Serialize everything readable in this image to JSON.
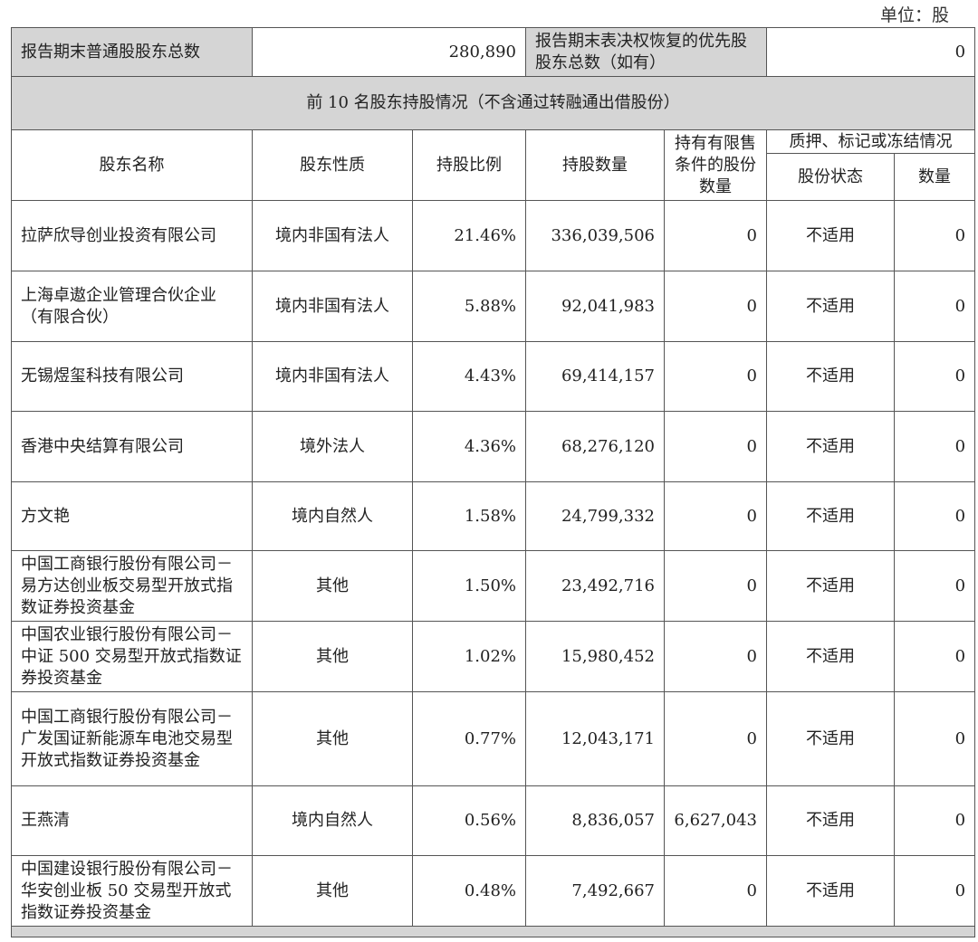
{
  "unit_label": "单位：股",
  "summary": {
    "total_holders_label": "报告期末普通股股东总数",
    "total_holders_value": "280,890",
    "preferred_label": "报告期末表决权恢复的优先股股东总数（如有）",
    "preferred_value": "0"
  },
  "section_title": "前 10 名股东持股情况（不含通过转融通出借股份）",
  "headers": {
    "name": "股东名称",
    "nature": "股东性质",
    "ratio": "持股比例",
    "quantity": "持股数量",
    "restricted": "持有有限售条件的股份数量",
    "pledge_group": "质押、标记或冻结情况",
    "pledge_status": "股份状态",
    "pledge_quantity": "数量"
  },
  "rows": [
    {
      "name": "拉萨欣导创业投资有限公司",
      "nature": "境内非国有法人",
      "ratio": "21.46%",
      "quantity": "336,039,506",
      "restricted": "0",
      "status": "不适用",
      "pledged": "0"
    },
    {
      "name": "上海卓遨企业管理合伙企业（有限合伙）",
      "nature": "境内非国有法人",
      "ratio": "5.88%",
      "quantity": "92,041,983",
      "restricted": "0",
      "status": "不适用",
      "pledged": "0"
    },
    {
      "name": "无锡煜玺科技有限公司",
      "nature": "境内非国有法人",
      "ratio": "4.43%",
      "quantity": "69,414,157",
      "restricted": "0",
      "status": "不适用",
      "pledged": "0"
    },
    {
      "name": "香港中央结算有限公司",
      "nature": "境外法人",
      "ratio": "4.36%",
      "quantity": "68,276,120",
      "restricted": "0",
      "status": "不适用",
      "pledged": "0"
    },
    {
      "name": "方文艳",
      "nature": "境内自然人",
      "ratio": "1.58%",
      "quantity": "24,799,332",
      "restricted": "0",
      "status": "不适用",
      "pledged": "0"
    },
    {
      "name": "中国工商银行股份有限公司－易方达创业板交易型开放式指数证券投资基金",
      "nature": "其他",
      "ratio": "1.50%",
      "quantity": "23,492,716",
      "restricted": "0",
      "status": "不适用",
      "pledged": "0"
    },
    {
      "name": "中国农业银行股份有限公司－中证 500 交易型开放式指数证券投资基金",
      "nature": "其他",
      "ratio": "1.02%",
      "quantity": "15,980,452",
      "restricted": "0",
      "status": "不适用",
      "pledged": "0"
    },
    {
      "name": "中国工商银行股份有限公司－广发国证新能源车电池交易型开放式指数证券投资基金",
      "nature": "其他",
      "ratio": "0.77%",
      "quantity": "12,043,171",
      "restricted": "0",
      "status": "不适用",
      "pledged": "0"
    },
    {
      "name": "王燕清",
      "nature": "境内自然人",
      "ratio": "0.56%",
      "quantity": "8,836,057",
      "restricted": "6,627,043",
      "status": "不适用",
      "pledged": "0"
    },
    {
      "name": "中国建设银行股份有限公司－华安创业板 50 交易型开放式指数证券投资基金",
      "nature": "其他",
      "ratio": "0.48%",
      "quantity": "7,492,667",
      "restricted": "0",
      "status": "不适用",
      "pledged": "0"
    }
  ]
}
